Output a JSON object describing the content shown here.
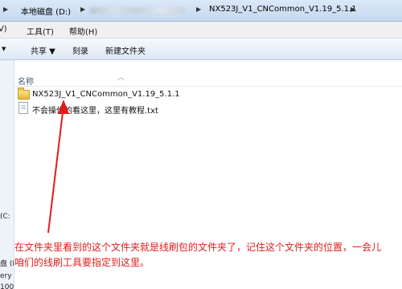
{
  "address_bar": {
    "left_fragment": "▶",
    "segments": [
      "本地磁盘 (D:)",
      "▶",
      "▶",
      "NX523J_V1_CNCommon_V1.19_5.1.1",
      "▶"
    ]
  },
  "menu": {
    "left_fragment": "(V)",
    "tools": "工具(T)",
    "help": "帮助(H)"
  },
  "toolbar": {
    "left_fragment": "▼",
    "share": "共享 ▼",
    "burn": "刻录",
    "new_folder": "新建文件夹"
  },
  "nav_pane": {
    "fragments": [
      "(C:",
      "盘 (F",
      "ery",
      "100"
    ]
  },
  "list": {
    "column_name": "名称",
    "items": [
      {
        "label": "NX523J_V1_CNCommon_V1.19_5.1.1",
        "icon": "folder-icon"
      },
      {
        "label": "不会操作的看这里，这里有教程.txt",
        "icon": "txt-file-icon"
      }
    ]
  },
  "annotation": {
    "text": "在文件夹里看到的这个文件夹就是线刷包的文件夹了，记住这个文件夹的位置，一会儿咱们的线刷工具要指定到这里。",
    "color": "#e21b1b"
  }
}
